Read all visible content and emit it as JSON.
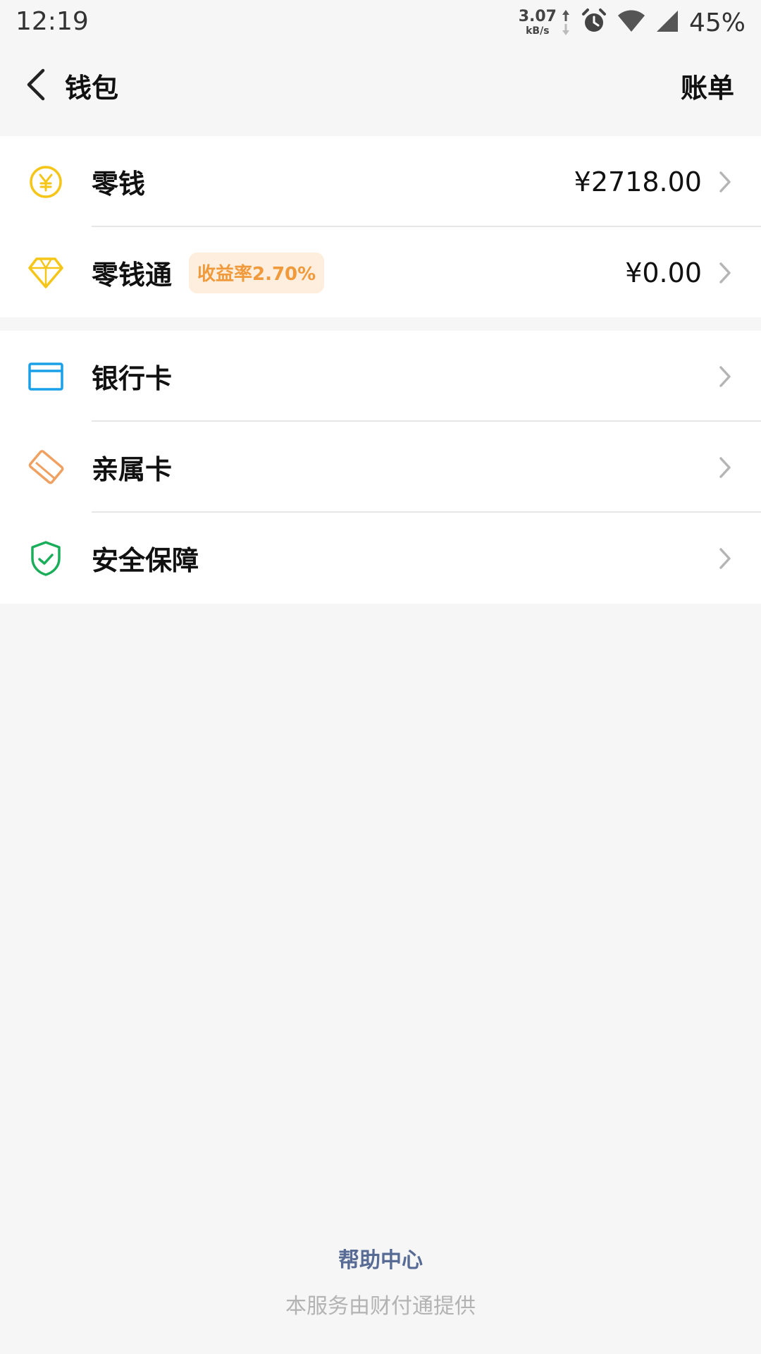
{
  "status_bar": {
    "time": "12:19",
    "net_speed": "3.07",
    "net_unit": "kB/s",
    "battery": "45%",
    "icons": [
      "alarm-icon",
      "wifi-icon",
      "signal-icon"
    ]
  },
  "nav": {
    "title": "钱包",
    "action": "账单"
  },
  "groups": [
    {
      "items": [
        {
          "icon": "yuan-coin-icon",
          "label": "零钱",
          "value": "¥2718.00"
        },
        {
          "icon": "diamond-icon",
          "label": "零钱通",
          "badge": "收益率2.70%",
          "value": "¥0.00"
        }
      ]
    },
    {
      "items": [
        {
          "icon": "bank-card-icon",
          "label": "银行卡"
        },
        {
          "icon": "family-card-icon",
          "label": "亲属卡"
        },
        {
          "icon": "shield-check-icon",
          "label": "安全保障"
        }
      ]
    }
  ],
  "footer": {
    "help": "帮助中心",
    "provider": "本服务由财付通提供"
  },
  "colors": {
    "background": "#f6f6f6",
    "card": "#ffffff",
    "coin_yellow": "#f5c518",
    "bank_blue": "#1aa0e8",
    "family_orange": "#f0a060",
    "shield_green": "#1aad5a",
    "badge_bg": "#fdeede",
    "badge_text": "#f09a3c",
    "link_blue": "#576b95"
  }
}
